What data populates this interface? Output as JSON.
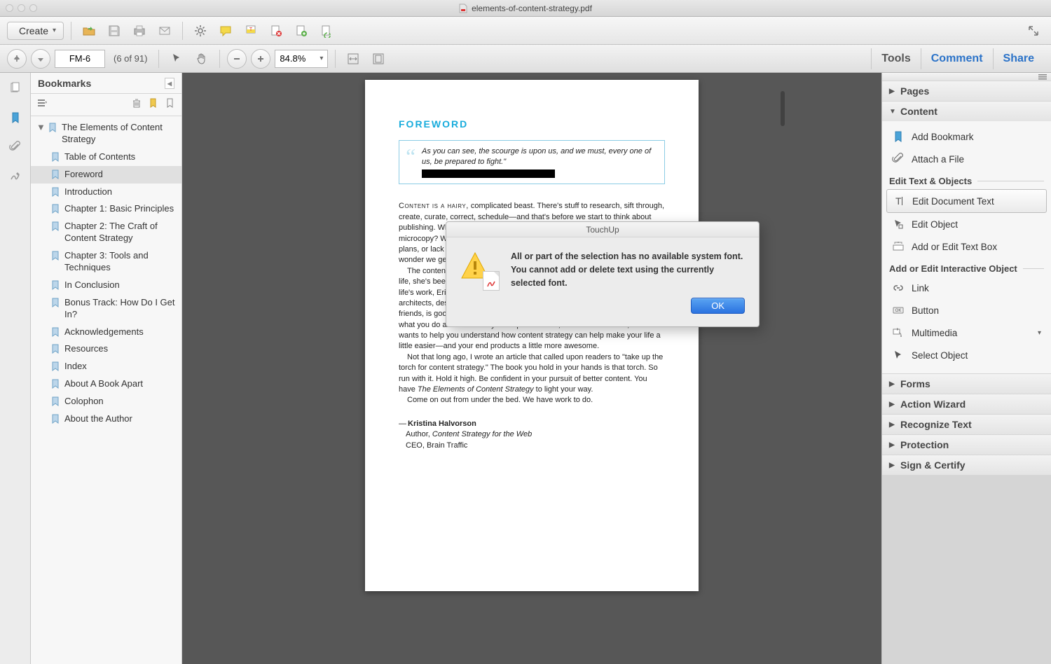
{
  "window": {
    "filename": "elements-of-content-strategy.pdf"
  },
  "toolbar1": {
    "create_label": "Create"
  },
  "toolbar2": {
    "page_label": "FM-6",
    "page_of": "(6 of 91)",
    "zoom": "84.8%",
    "tools": "Tools",
    "comment": "Comment",
    "share": "Share"
  },
  "bookmarks": {
    "title": "Bookmarks",
    "items": [
      {
        "label": "The Elements of Content Strategy",
        "top": true
      },
      {
        "label": "Table of Contents"
      },
      {
        "label": "Foreword",
        "selected": true
      },
      {
        "label": "Introduction"
      },
      {
        "label": "Chapter 1: Basic Principles"
      },
      {
        "label": "Chapter 2: The Craft of Content Strategy"
      },
      {
        "label": "Chapter 3: Tools and Techniques"
      },
      {
        "label": "In Conclusion"
      },
      {
        "label": "Bonus Track: How Do I Get In?"
      },
      {
        "label": "Acknowledgements"
      },
      {
        "label": "Resources"
      },
      {
        "label": "Index"
      },
      {
        "label": "About A Book Apart"
      },
      {
        "label": "Colophon"
      },
      {
        "label": "About the Author"
      }
    ]
  },
  "page": {
    "heading": "FOREWORD",
    "quote": "As you can see, the scourge is upon us, and we must, every one of us, be prepared to fight.\"",
    "p1": "CONTENT IS A HAIRY, complicated beast. There's stuff to research, sift through, create, curate, correct, schedule—and that's before we start to think about publishing. What layout makes the most sense for readers? What about microcopy? What metaschema? What governance model? With the best plans, or lack of resources, or conflicting stakeholder priorities or...yikes. No wonder we get it wrong sometimes.",
    "p2": "The content beast doesn't scare Erin Kissane. A born editor her entire adult life, she's been taming that beast with a firm but gentle hand. As part of her life's work, Erin has consulted and collaborated with countless information architects, designers, marketers, editors, and writing strategists. And that, friends, is good news for you: not only has Erin seen and done it all, she loves what you do and knows why it's important. And, because she cares, she wants to help you understand how content strategy can help make your life a little easier—and your end products a little more awesome.",
    "p3": "Not that long ago, I wrote an article that called upon readers to \"take up the torch for content strategy.\" The book you hold in your hands is that torch. So run with it. Hold it high. Be confident in your pursuit of better content. You have The Elements of Content Strategy to light your way.",
    "p4": "Come on out from under the bed. We have work to do.",
    "sig_name": "Kristina Halvorson",
    "sig_line2": "Author, Content Strategy for the Web",
    "sig_line3": "CEO, Brain Traffic"
  },
  "rightpanel": {
    "pages": "Pages",
    "content": "Content",
    "add_bookmark": "Add Bookmark",
    "attach_file": "Attach a File",
    "h_edit": "Edit Text & Objects",
    "edit_doc_text": "Edit Document Text",
    "edit_object": "Edit Object",
    "add_textbox": "Add or Edit Text Box",
    "h_interactive": "Add or Edit Interactive Object",
    "link": "Link",
    "button": "Button",
    "multimedia": "Multimedia",
    "select_object": "Select Object",
    "forms": "Forms",
    "action_wizard": "Action Wizard",
    "recognize_text": "Recognize Text",
    "protection": "Protection",
    "sign_certify": "Sign & Certify"
  },
  "dialog": {
    "title": "TouchUp",
    "text": "All or part of the selection has no available system font. You cannot add or delete text using the currently selected font.",
    "ok": "OK"
  }
}
